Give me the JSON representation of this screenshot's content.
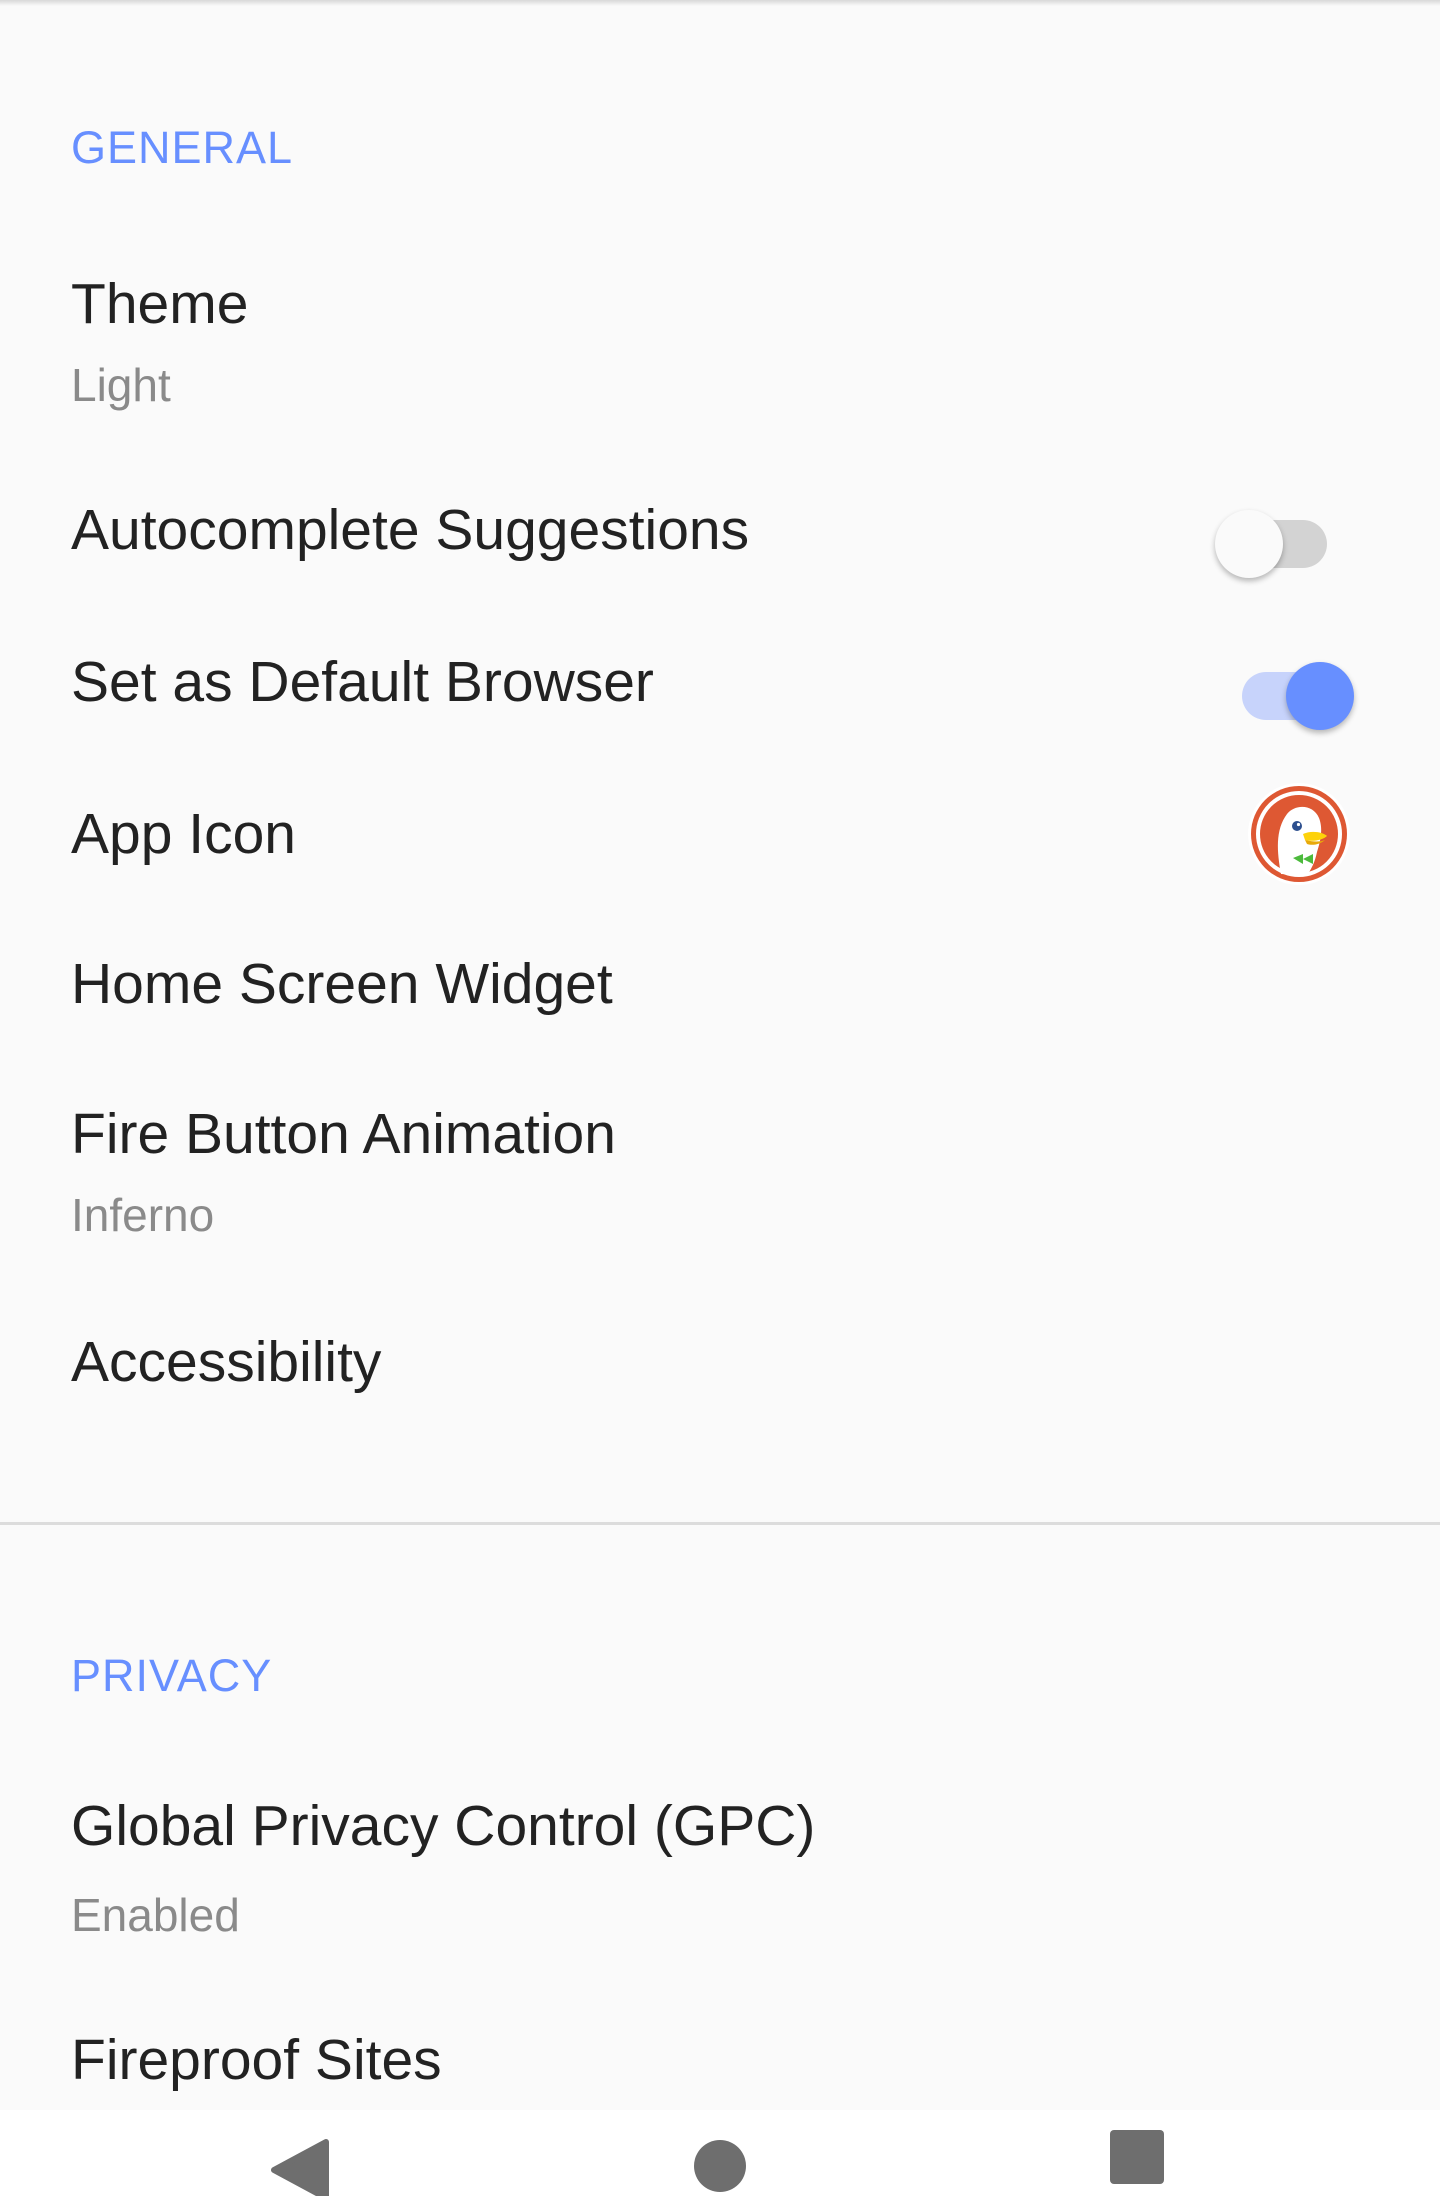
{
  "general": {
    "header": "GENERAL",
    "theme": {
      "title": "Theme",
      "value": "Light"
    },
    "autocomplete": {
      "title": "Autocomplete Suggestions",
      "enabled": false
    },
    "default_browser": {
      "title": "Set as Default Browser",
      "enabled": true
    },
    "app_icon": {
      "title": "App Icon",
      "icon": "duckduckgo-logo-icon"
    },
    "home_widget": {
      "title": "Home Screen Widget"
    },
    "fire_animation": {
      "title": "Fire Button Animation",
      "value": "Inferno"
    },
    "accessibility": {
      "title": "Accessibility"
    }
  },
  "privacy": {
    "header": "PRIVACY",
    "gpc": {
      "title": "Global Privacy Control (GPC)",
      "value": "Enabled"
    },
    "fireproof": {
      "title": "Fireproof Sites"
    }
  },
  "navbar": {
    "icons": [
      "back-triangle-icon",
      "home-circle-icon",
      "recents-square-icon"
    ]
  },
  "colors": {
    "accent": "#678fff",
    "background": "#fafafa",
    "title_text": "#222222",
    "subtitle_text": "#8a8a8a"
  }
}
